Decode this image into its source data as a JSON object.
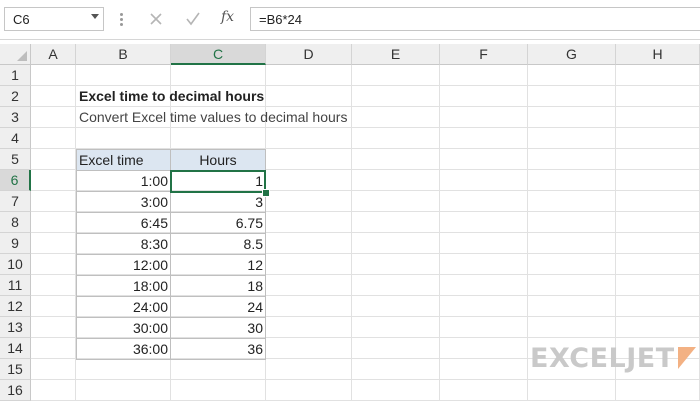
{
  "formula_bar": {
    "name_box": "C6",
    "cancel_icon": "cancel-icon",
    "enter_icon": "checkmark-icon",
    "fx_label": "fx",
    "formula": "=B6*24"
  },
  "columns": [
    "A",
    "B",
    "C",
    "D",
    "E",
    "F",
    "G",
    "H"
  ],
  "rows": [
    "1",
    "2",
    "3",
    "4",
    "5",
    "6",
    "7",
    "8",
    "9",
    "10",
    "11",
    "12",
    "13",
    "14",
    "15",
    "16"
  ],
  "selected": {
    "column": "C",
    "row": "6",
    "cell": "C6"
  },
  "sheet": {
    "title": "Excel time to decimal hours",
    "subtitle": "Convert Excel time values to decimal hours"
  },
  "table": {
    "headers": [
      "Excel time",
      "Hours"
    ],
    "rows": [
      [
        "1:00",
        "1"
      ],
      [
        "3:00",
        "3"
      ],
      [
        "6:45",
        "6.75"
      ],
      [
        "8:30",
        "8.5"
      ],
      [
        "12:00",
        "12"
      ],
      [
        "18:00",
        "18"
      ],
      [
        "24:00",
        "24"
      ],
      [
        "30:00",
        "30"
      ],
      [
        "36:00",
        "36"
      ]
    ]
  },
  "logo": {
    "text": "EXCELJET"
  },
  "colors": {
    "accent": "#217346",
    "header_fill": "#dce6f1",
    "logo": "#c9c9c9",
    "logo_mark": "#f3b183"
  }
}
